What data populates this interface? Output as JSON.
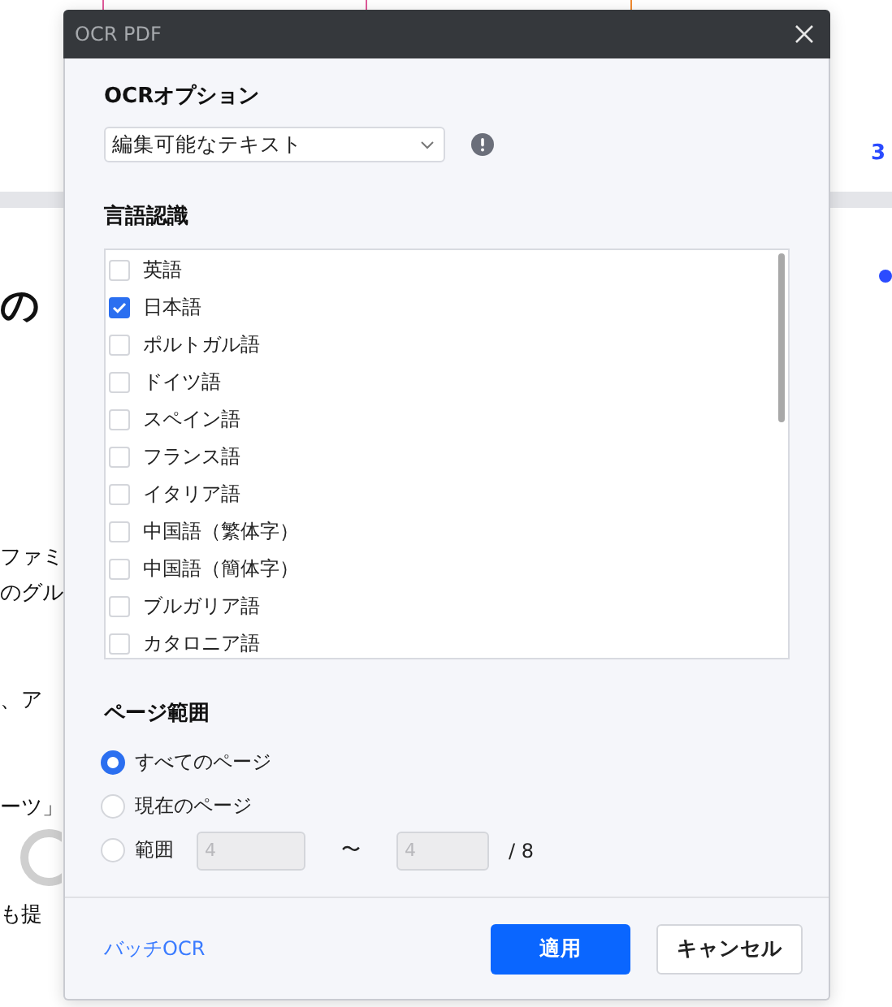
{
  "background_page": {
    "page_number": "3",
    "fragments": [
      {
        "text": "の",
        "kind": "heading"
      },
      {
        "text": "ファミ",
        "kind": "body"
      },
      {
        "text": "のグル",
        "kind": "body"
      },
      {
        "text": "、ア",
        "kind": "body"
      },
      {
        "text": "ーツ」",
        "kind": "body"
      },
      {
        "text": "も提",
        "kind": "body"
      }
    ]
  },
  "dialog": {
    "title": "OCR PDF",
    "ocr_options": {
      "label": "OCRオプション",
      "value": "編集可能なテキスト"
    },
    "language": {
      "label": "言語認識",
      "languages": [
        {
          "name": "英語",
          "checked": false
        },
        {
          "name": "日本語",
          "checked": true
        },
        {
          "name": "ポルトガル語",
          "checked": false
        },
        {
          "name": "ドイツ語",
          "checked": false
        },
        {
          "name": "スペイン語",
          "checked": false
        },
        {
          "name": "フランス語",
          "checked": false
        },
        {
          "name": "イタリア語",
          "checked": false
        },
        {
          "name": "中国語（繁体字）",
          "checked": false
        },
        {
          "name": "中国語（簡体字）",
          "checked": false
        },
        {
          "name": "ブルガリア語",
          "checked": false
        },
        {
          "name": "カタロニア語",
          "checked": false
        }
      ]
    },
    "page_range": {
      "label": "ページ範囲",
      "options": [
        {
          "label": "すべてのページ",
          "selected": true,
          "kind": "plain"
        },
        {
          "label": "現在のページ",
          "selected": false,
          "kind": "plain"
        },
        {
          "label": "範囲",
          "selected": false,
          "kind": "range"
        }
      ],
      "range": {
        "from": "4",
        "separator": "〜",
        "to": "4",
        "total": "/ 8",
        "disabled": true
      }
    },
    "footer": {
      "batch_link": "バッチOCR",
      "buttons": [
        {
          "label": "適用",
          "kind": "primary"
        },
        {
          "label": "キャンセル",
          "kind": "secondary"
        }
      ]
    }
  }
}
